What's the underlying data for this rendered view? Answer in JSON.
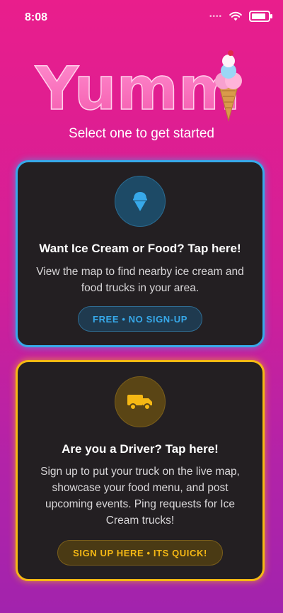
{
  "status_bar": {
    "time": "8:08"
  },
  "logo": {
    "text": "Yumm"
  },
  "tagline": "Select one to get started",
  "cards": {
    "customer": {
      "title": "Want Ice Cream or Food? Tap here!",
      "description": "View the map to find nearby ice cream and food trucks in your area.",
      "pill_label": "FREE • NO SIGN-UP",
      "accent_color": "#37a9ea",
      "icon": "ice-cream-icon"
    },
    "driver": {
      "title": "Are you a Driver? Tap here!",
      "description": "Sign up to put your truck on the live map, showcase your food menu, and post upcoming events. Ping requests for Ice Cream trucks!",
      "pill_label": "SIGN UP HERE • ITS QUICK!",
      "accent_color": "#f5b814",
      "icon": "truck-icon"
    }
  },
  "colors": {
    "background_top": "#e91e8c",
    "background_bottom": "#a223ad",
    "card_background": "#231f22"
  }
}
